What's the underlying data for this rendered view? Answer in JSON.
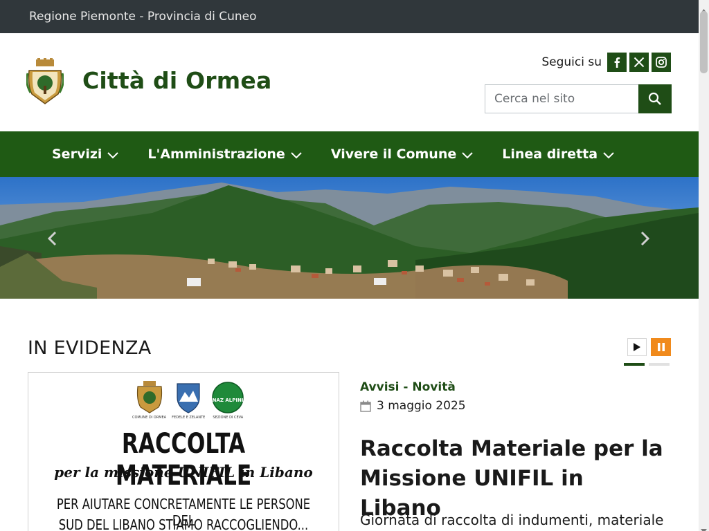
{
  "topbar": {
    "text": "Regione Piemonte - Provincia di Cuneo"
  },
  "header": {
    "site_title": "Città di Ormea",
    "social_label": "Seguici su",
    "social": [
      {
        "name": "facebook-icon",
        "glyph": "f"
      },
      {
        "name": "x-twitter-icon",
        "glyph": "X"
      },
      {
        "name": "instagram-icon",
        "glyph": "ig"
      }
    ],
    "search_placeholder": "Cerca nel sito"
  },
  "nav": {
    "items": [
      {
        "label": "Servizi"
      },
      {
        "label": "L'Amministrazione"
      },
      {
        "label": "Vivere il Comune"
      },
      {
        "label": "Linea diretta"
      }
    ]
  },
  "evidenza": {
    "title": "IN EVIDENZA",
    "poster": {
      "logo_labels": [
        "COMUNE DI ORMEA",
        "FEDELE E ZELANTE",
        "SEZIONE DI CEVA"
      ],
      "badge_text": "NAZ ALPINI",
      "title": "RACCOLTA MATERIALE",
      "subtitle": "per la missione UNIFIL in Libano",
      "line1": "PER AIUTARE CONCRETAMENTE LE  PERSONE DEL",
      "line2": "SUD DEL LIBANO STIAMO RACCOGLIENDO..."
    },
    "category": "Avvisi - Novità",
    "date": "3 maggio 2025",
    "headline": "Raccolta Materiale per la Missione UNIFIL in Libano",
    "excerpt": "Giornata di raccolta di indumenti, materiale"
  },
  "colors": {
    "brand_green": "#1f4d16",
    "nav_green": "#1f5a14",
    "topbar_dark": "#30373b",
    "pause_orange": "#f08a1c"
  }
}
